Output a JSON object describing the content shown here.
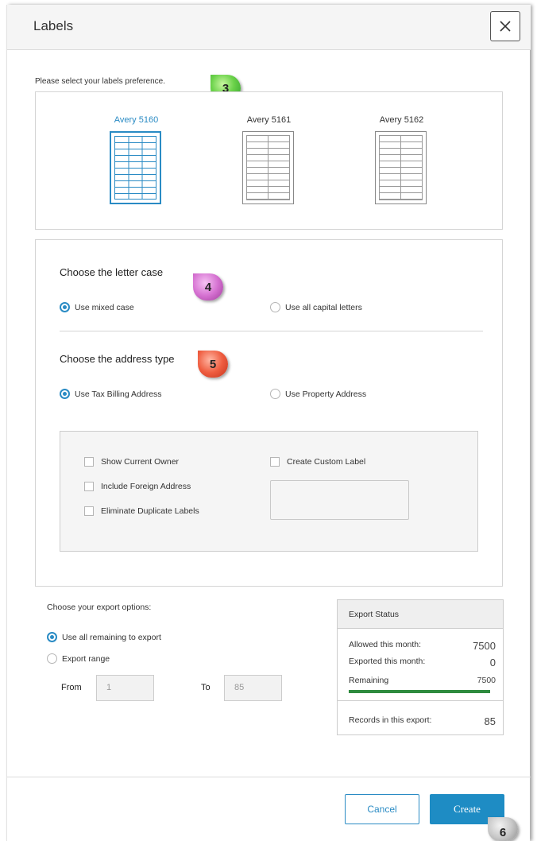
{
  "dialog": {
    "title": "Labels"
  },
  "callouts": {
    "c3": "3",
    "c4": "4",
    "c5": "5",
    "c6": "6"
  },
  "labels": {
    "prompt": "Please select your labels preference.",
    "options": [
      {
        "name": "Avery 5160",
        "selected": true
      },
      {
        "name": "Avery 5161",
        "selected": false
      },
      {
        "name": "Avery 5162",
        "selected": false
      }
    ]
  },
  "letter_case": {
    "title": "Choose the letter case",
    "options": [
      {
        "label": "Use mixed case",
        "selected": true
      },
      {
        "label": "Use all capital letters",
        "selected": false
      }
    ]
  },
  "address_type": {
    "title": "Choose the address type",
    "options": [
      {
        "label": "Use Tax Billing Address",
        "selected": true
      },
      {
        "label": "Use Property Address",
        "selected": false
      }
    ]
  },
  "extras": {
    "checkboxes": [
      {
        "label": "Show Current Owner",
        "checked": false
      },
      {
        "label": "Include Foreign Address",
        "checked": false
      },
      {
        "label": "Eliminate Duplicate Labels",
        "checked": false
      },
      {
        "label": "Create Custom Label",
        "checked": false
      }
    ],
    "custom_label_value": ""
  },
  "export": {
    "title": "Choose your export options:",
    "options": [
      {
        "label": "Use all remaining to export",
        "selected": true
      },
      {
        "label": "Export range",
        "selected": false
      }
    ],
    "from_label": "From",
    "from_value": "1",
    "to_label": "To",
    "to_value": "85"
  },
  "export_status": {
    "title": "Export Status",
    "allowed_label": "Allowed this month:",
    "allowed_value": "7500",
    "exported_label": "Exported this month:",
    "exported_value": "0",
    "remaining_label": "Remaining",
    "remaining_value": "7500",
    "remaining_fraction": 1.0,
    "records_label": "Records in this export:",
    "records_value": "85",
    "bar_color": "#2e8b3e"
  },
  "buttons": {
    "cancel": "Cancel",
    "create": "Create"
  },
  "colors": {
    "accent": "#2a8bc4",
    "primary_button": "#1e8cc4"
  }
}
